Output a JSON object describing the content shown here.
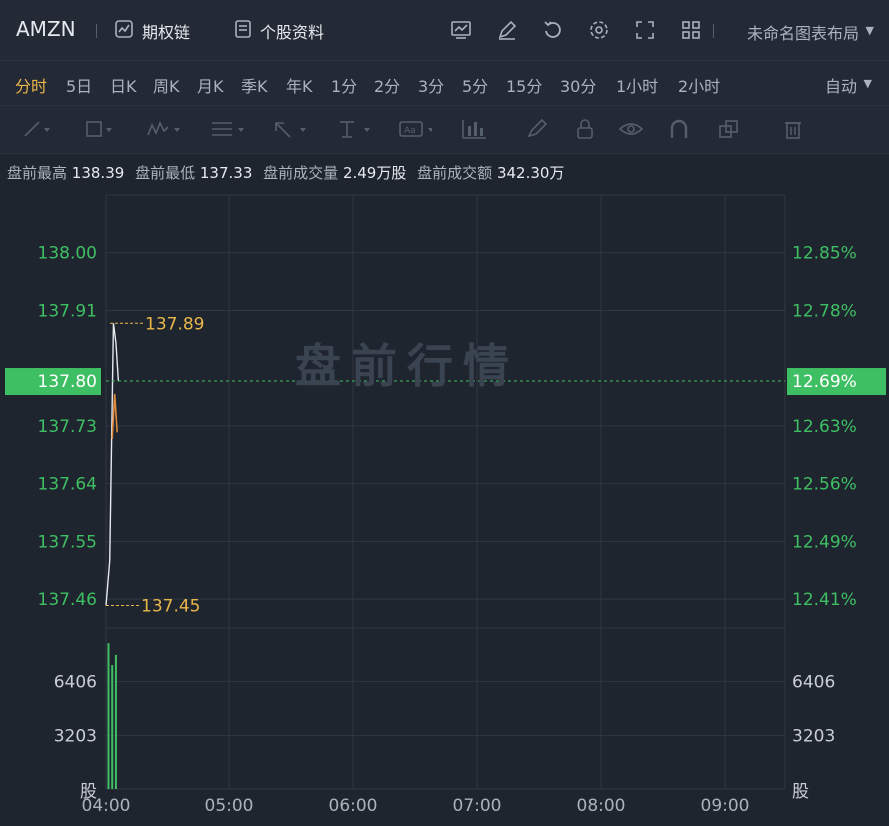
{
  "header": {
    "symbol": "AMZN",
    "options_chain": "期权链",
    "profile": "个股资料",
    "layout_name": "未命名图表布局"
  },
  "periods": [
    "分时",
    "5日",
    "日K",
    "周K",
    "月K",
    "季K",
    "年K",
    "1分",
    "2分",
    "3分",
    "5分",
    "15分",
    "30分",
    "1小时",
    "2小时"
  ],
  "active_period": "分时",
  "scale_mode": "自动",
  "info_bar": {
    "high_label": "盘前最高",
    "high_value": "138.39",
    "low_label": "盘前最低",
    "low_value": "137.33",
    "volume_label": "盘前成交量",
    "volume_value": "2.49万股",
    "turnover_label": "盘前成交额",
    "turnover_value": "342.30万"
  },
  "watermark": "盘前行情",
  "colors": {
    "up": "#3fbf63",
    "accent": "#e9b64a",
    "price_line": "#e6e9ee",
    "avg_line": "#e08a3c",
    "grid": "#2f3742"
  },
  "chart_data": {
    "type": "line",
    "x_ticks": [
      "04:00",
      "05:00",
      "06:00",
      "07:00",
      "08:00",
      "09:00"
    ],
    "price_ticks_left": [
      "138.00",
      "137.91",
      "137.73",
      "137.64",
      "137.55",
      "137.46"
    ],
    "price_ticks_right": [
      "12.85%",
      "12.78%",
      "12.63%",
      "12.56%",
      "12.49%",
      "12.41%"
    ],
    "price_tick_values": [
      138.0,
      137.91,
      137.73,
      137.64,
      137.55,
      137.46
    ],
    "price_ylim": [
      137.415,
      138.09
    ],
    "current_price": "137.80",
    "current_pct": "12.69%",
    "current_value": 137.8,
    "max_label": "137.89",
    "max_value": 137.89,
    "min_label": "137.45",
    "min_value": 137.45,
    "price_series": {
      "t": [
        0,
        0.03,
        0.06,
        0.08,
        0.1
      ],
      "values": [
        137.45,
        137.52,
        137.89,
        137.86,
        137.8
      ]
    },
    "avg_series": {
      "t": [
        0.05,
        0.07,
        0.09
      ],
      "values": [
        137.71,
        137.78,
        137.72
      ]
    },
    "volume_ticks": [
      "6406",
      "3203"
    ],
    "volume_tick_values": [
      6406,
      3203
    ],
    "volume_unit": "股",
    "volume_ylim": [
      0,
      9609
    ],
    "volume_bars": {
      "t": [
        0.02,
        0.05,
        0.08
      ],
      "values": [
        8700,
        7400,
        8000
      ]
    }
  }
}
